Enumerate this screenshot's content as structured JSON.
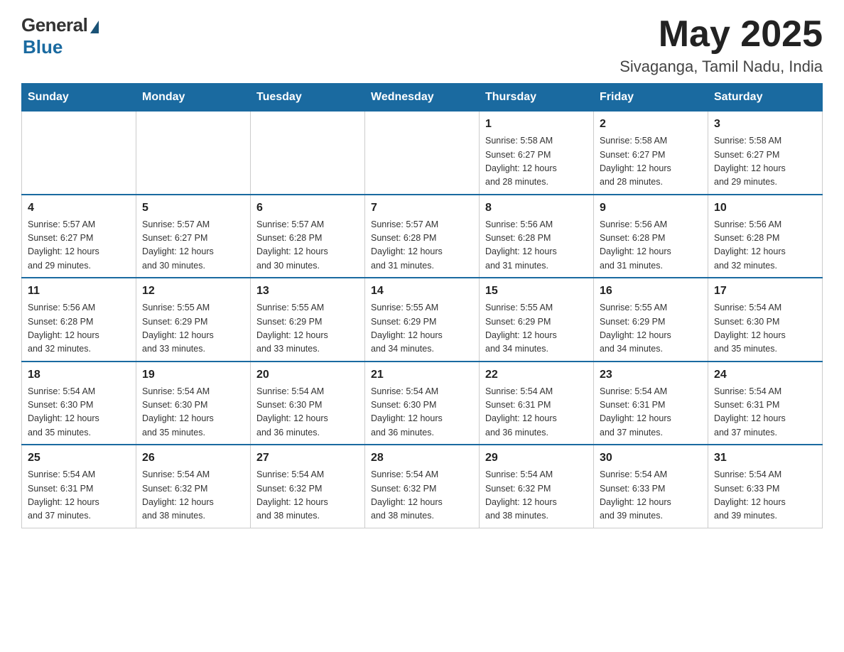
{
  "logo": {
    "general": "General",
    "blue": "Blue"
  },
  "header": {
    "month_year": "May 2025",
    "location": "Sivaganga, Tamil Nadu, India"
  },
  "days_of_week": [
    "Sunday",
    "Monday",
    "Tuesday",
    "Wednesday",
    "Thursday",
    "Friday",
    "Saturday"
  ],
  "weeks": [
    [
      {
        "day": "",
        "info": ""
      },
      {
        "day": "",
        "info": ""
      },
      {
        "day": "",
        "info": ""
      },
      {
        "day": "",
        "info": ""
      },
      {
        "day": "1",
        "info": "Sunrise: 5:58 AM\nSunset: 6:27 PM\nDaylight: 12 hours\nand 28 minutes."
      },
      {
        "day": "2",
        "info": "Sunrise: 5:58 AM\nSunset: 6:27 PM\nDaylight: 12 hours\nand 28 minutes."
      },
      {
        "day": "3",
        "info": "Sunrise: 5:58 AM\nSunset: 6:27 PM\nDaylight: 12 hours\nand 29 minutes."
      }
    ],
    [
      {
        "day": "4",
        "info": "Sunrise: 5:57 AM\nSunset: 6:27 PM\nDaylight: 12 hours\nand 29 minutes."
      },
      {
        "day": "5",
        "info": "Sunrise: 5:57 AM\nSunset: 6:27 PM\nDaylight: 12 hours\nand 30 minutes."
      },
      {
        "day": "6",
        "info": "Sunrise: 5:57 AM\nSunset: 6:28 PM\nDaylight: 12 hours\nand 30 minutes."
      },
      {
        "day": "7",
        "info": "Sunrise: 5:57 AM\nSunset: 6:28 PM\nDaylight: 12 hours\nand 31 minutes."
      },
      {
        "day": "8",
        "info": "Sunrise: 5:56 AM\nSunset: 6:28 PM\nDaylight: 12 hours\nand 31 minutes."
      },
      {
        "day": "9",
        "info": "Sunrise: 5:56 AM\nSunset: 6:28 PM\nDaylight: 12 hours\nand 31 minutes."
      },
      {
        "day": "10",
        "info": "Sunrise: 5:56 AM\nSunset: 6:28 PM\nDaylight: 12 hours\nand 32 minutes."
      }
    ],
    [
      {
        "day": "11",
        "info": "Sunrise: 5:56 AM\nSunset: 6:28 PM\nDaylight: 12 hours\nand 32 minutes."
      },
      {
        "day": "12",
        "info": "Sunrise: 5:55 AM\nSunset: 6:29 PM\nDaylight: 12 hours\nand 33 minutes."
      },
      {
        "day": "13",
        "info": "Sunrise: 5:55 AM\nSunset: 6:29 PM\nDaylight: 12 hours\nand 33 minutes."
      },
      {
        "day": "14",
        "info": "Sunrise: 5:55 AM\nSunset: 6:29 PM\nDaylight: 12 hours\nand 34 minutes."
      },
      {
        "day": "15",
        "info": "Sunrise: 5:55 AM\nSunset: 6:29 PM\nDaylight: 12 hours\nand 34 minutes."
      },
      {
        "day": "16",
        "info": "Sunrise: 5:55 AM\nSunset: 6:29 PM\nDaylight: 12 hours\nand 34 minutes."
      },
      {
        "day": "17",
        "info": "Sunrise: 5:54 AM\nSunset: 6:30 PM\nDaylight: 12 hours\nand 35 minutes."
      }
    ],
    [
      {
        "day": "18",
        "info": "Sunrise: 5:54 AM\nSunset: 6:30 PM\nDaylight: 12 hours\nand 35 minutes."
      },
      {
        "day": "19",
        "info": "Sunrise: 5:54 AM\nSunset: 6:30 PM\nDaylight: 12 hours\nand 35 minutes."
      },
      {
        "day": "20",
        "info": "Sunrise: 5:54 AM\nSunset: 6:30 PM\nDaylight: 12 hours\nand 36 minutes."
      },
      {
        "day": "21",
        "info": "Sunrise: 5:54 AM\nSunset: 6:30 PM\nDaylight: 12 hours\nand 36 minutes."
      },
      {
        "day": "22",
        "info": "Sunrise: 5:54 AM\nSunset: 6:31 PM\nDaylight: 12 hours\nand 36 minutes."
      },
      {
        "day": "23",
        "info": "Sunrise: 5:54 AM\nSunset: 6:31 PM\nDaylight: 12 hours\nand 37 minutes."
      },
      {
        "day": "24",
        "info": "Sunrise: 5:54 AM\nSunset: 6:31 PM\nDaylight: 12 hours\nand 37 minutes."
      }
    ],
    [
      {
        "day": "25",
        "info": "Sunrise: 5:54 AM\nSunset: 6:31 PM\nDaylight: 12 hours\nand 37 minutes."
      },
      {
        "day": "26",
        "info": "Sunrise: 5:54 AM\nSunset: 6:32 PM\nDaylight: 12 hours\nand 38 minutes."
      },
      {
        "day": "27",
        "info": "Sunrise: 5:54 AM\nSunset: 6:32 PM\nDaylight: 12 hours\nand 38 minutes."
      },
      {
        "day": "28",
        "info": "Sunrise: 5:54 AM\nSunset: 6:32 PM\nDaylight: 12 hours\nand 38 minutes."
      },
      {
        "day": "29",
        "info": "Sunrise: 5:54 AM\nSunset: 6:32 PM\nDaylight: 12 hours\nand 38 minutes."
      },
      {
        "day": "30",
        "info": "Sunrise: 5:54 AM\nSunset: 6:33 PM\nDaylight: 12 hours\nand 39 minutes."
      },
      {
        "day": "31",
        "info": "Sunrise: 5:54 AM\nSunset: 6:33 PM\nDaylight: 12 hours\nand 39 minutes."
      }
    ]
  ]
}
